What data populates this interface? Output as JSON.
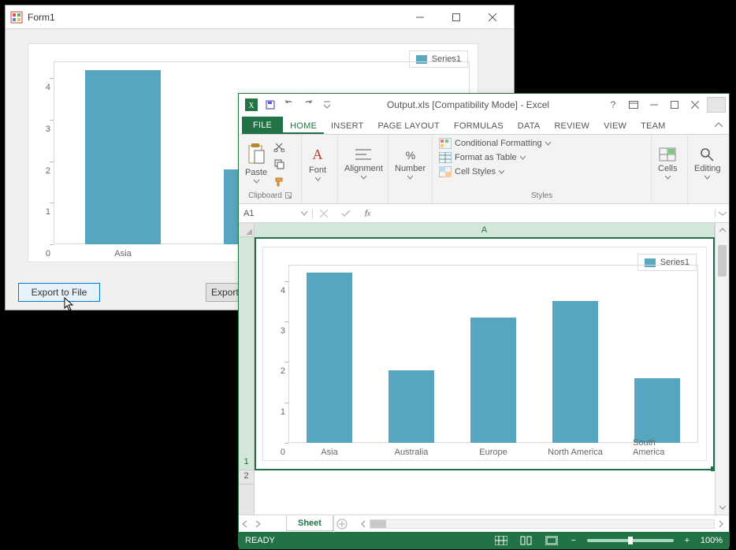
{
  "form": {
    "title": "Form1",
    "buttons": {
      "export_file": "Export to File",
      "export_stream": "Export to Stream"
    }
  },
  "excel": {
    "title": "Output.xls  [Compatibility Mode] - Excel",
    "tabs": {
      "file": "FILE",
      "home": "HOME",
      "insert": "INSERT",
      "page_layout": "PAGE LAYOUT",
      "formulas": "FORMULAS",
      "data": "DATA",
      "review": "REVIEW",
      "view": "VIEW",
      "team": "TEAM"
    },
    "ribbon": {
      "clipboard": {
        "label": "Clipboard",
        "paste": "Paste"
      },
      "font": {
        "label": "Font"
      },
      "alignment": {
        "label": "Alignment"
      },
      "number": {
        "label": "Number"
      },
      "styles": {
        "label": "Styles",
        "cond": "Conditional Formatting",
        "table": "Format as Table",
        "cell": "Cell Styles"
      },
      "cells": {
        "label": "Cells"
      },
      "editing": {
        "label": "Editing"
      }
    },
    "name_box": "A1",
    "sheet_tab": "Sheet",
    "status": "READY",
    "zoom": "100%",
    "column": "A",
    "rows": {
      "r1": "1",
      "r2": "2"
    }
  },
  "chart_data": [
    {
      "type": "bar",
      "title": "",
      "series": [
        {
          "name": "Series1",
          "values": [
            4.2,
            1.8,
            3.1
          ]
        }
      ],
      "categories": [
        "Asia",
        "Australia",
        "Europe"
      ],
      "xlabel": "",
      "ylabel": "",
      "ylim": [
        0,
        4.4
      ],
      "yticks": [
        0,
        1,
        2,
        3,
        4
      ]
    },
    {
      "type": "bar",
      "title": "",
      "series": [
        {
          "name": "Series1",
          "values": [
            4.2,
            1.8,
            3.1,
            3.5,
            1.6
          ]
        }
      ],
      "categories": [
        "Asia",
        "Australia",
        "Europe",
        "North America",
        "South America"
      ],
      "xlabel": "",
      "ylabel": "",
      "ylim": [
        0,
        4.4
      ],
      "yticks": [
        0,
        1,
        2,
        3,
        4
      ]
    }
  ]
}
